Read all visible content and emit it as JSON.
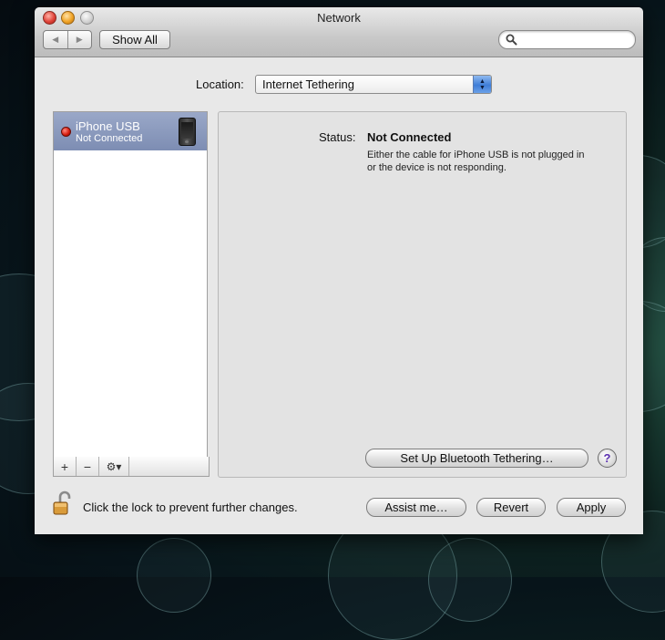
{
  "window": {
    "title": "Network"
  },
  "toolbar": {
    "back_icon": "back-arrow-icon",
    "forward_icon": "forward-arrow-icon",
    "show_all_label": "Show All",
    "search_placeholder": "",
    "search_value": ""
  },
  "location": {
    "label": "Location:",
    "value": "Internet Tethering"
  },
  "services": [
    {
      "name": "iPhone USB",
      "status": "Not Connected",
      "status_color": "#d4190b",
      "icon": "iphone-icon"
    }
  ],
  "service_toolbar": {
    "add": "+",
    "remove": "−",
    "action": "⚙▾"
  },
  "detail": {
    "status_label": "Status:",
    "status_value": "Not Connected",
    "status_description": "Either the cable for iPhone USB is not plugged in or the device is not responding.",
    "bluetooth_button": "Set Up Bluetooth Tethering…",
    "help_label": "?"
  },
  "footer": {
    "lock_text": "Click the lock to prevent further changes.",
    "assist_button": "Assist me…",
    "revert_button": "Revert",
    "apply_button": "Apply"
  },
  "colors": {
    "selection": "#8a98bd",
    "accent": "#3f7ed8"
  }
}
